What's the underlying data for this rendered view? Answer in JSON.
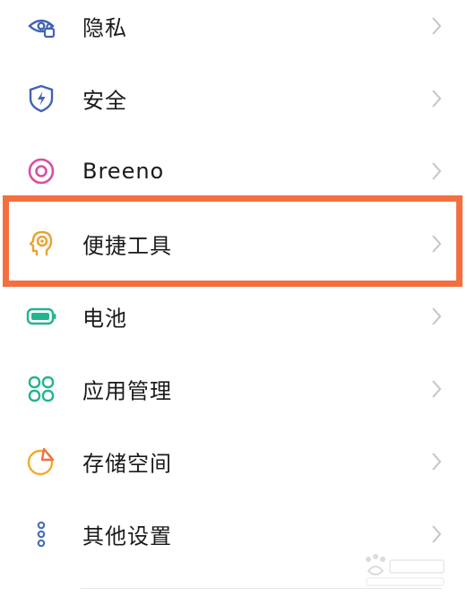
{
  "settings": {
    "items": [
      {
        "label": "隐私",
        "icon": "privacy-icon",
        "color": "#3f63b5"
      },
      {
        "label": "安全",
        "icon": "security-shield-icon",
        "color": "#3f63b5"
      },
      {
        "label": "Breeno",
        "icon": "breeno-icon",
        "color": "#d74fa3"
      },
      {
        "label": "便捷工具",
        "icon": "convenience-tools-icon",
        "color": "#e9a233"
      },
      {
        "label": "电池",
        "icon": "battery-icon",
        "color": "#23b48f"
      },
      {
        "label": "应用管理",
        "icon": "app-management-icon",
        "color": "#23b48f"
      },
      {
        "label": "存储空间",
        "icon": "storage-icon",
        "color": "#f3a92b"
      },
      {
        "label": "其他设置",
        "icon": "other-settings-icon",
        "color": "#4a6fb5"
      }
    ],
    "highlight_color": "#f36f3f",
    "chevron_icon": "chevron-right-icon"
  }
}
